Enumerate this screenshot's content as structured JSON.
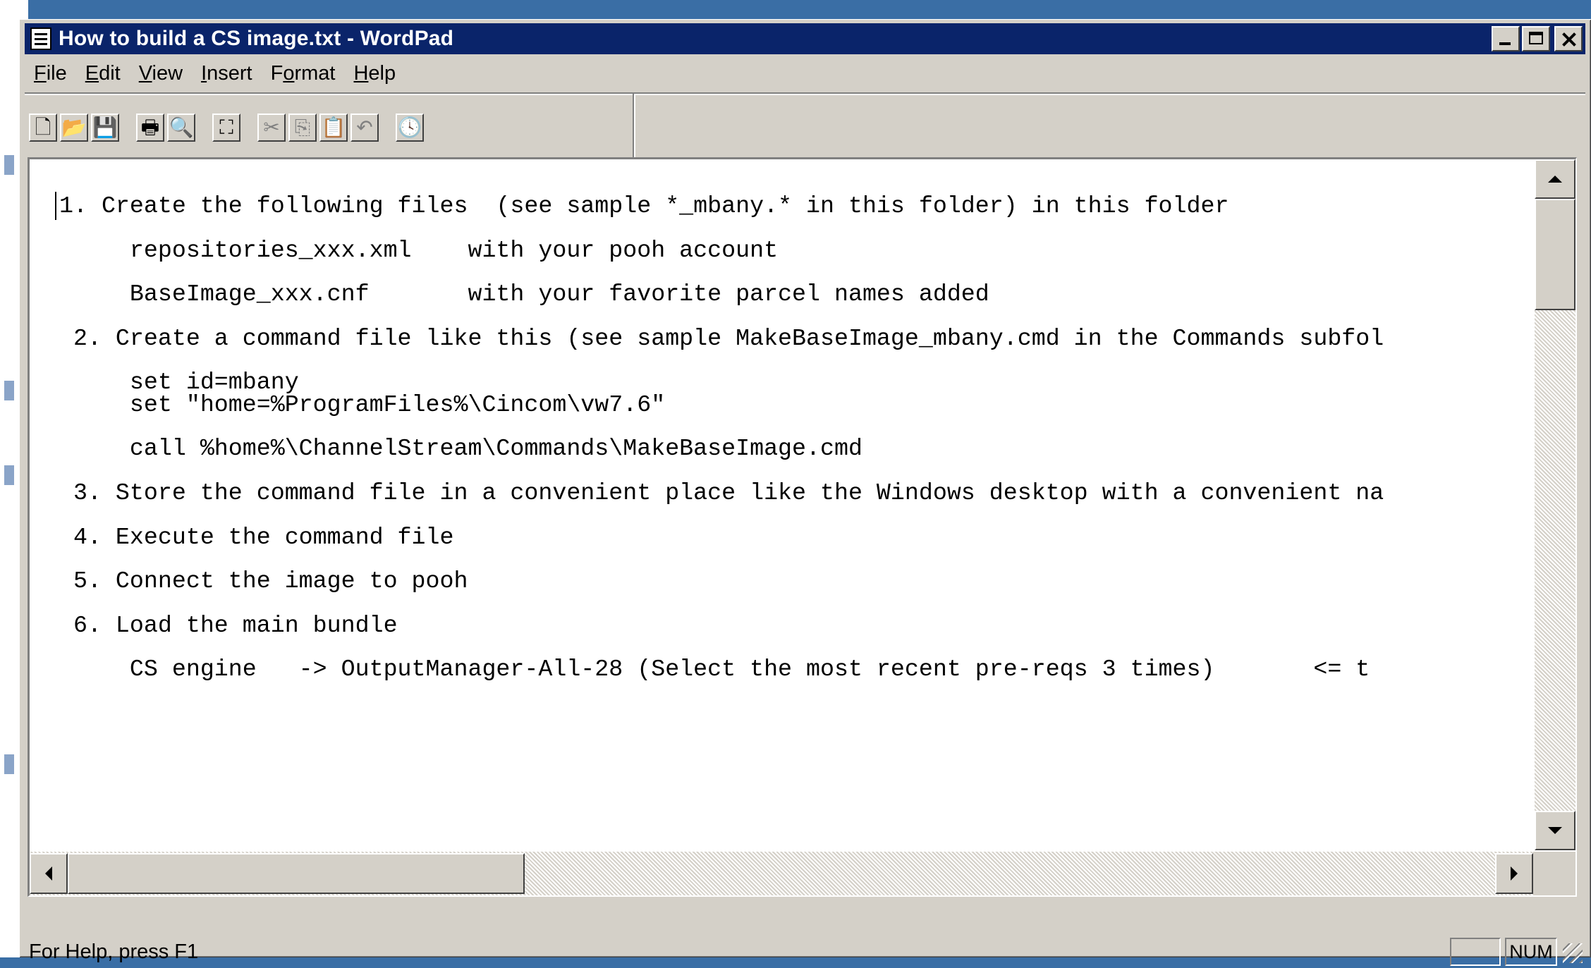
{
  "window": {
    "title": "How to build a CS image.txt - WordPad",
    "controls": {
      "minimize": "minimize",
      "maximize": "maximize",
      "close": "close"
    }
  },
  "menu": [
    {
      "pre": "",
      "key": "F",
      "post": "ile"
    },
    {
      "pre": "",
      "key": "E",
      "post": "dit"
    },
    {
      "pre": "",
      "key": "V",
      "post": "iew"
    },
    {
      "pre": "",
      "key": "I",
      "post": "nsert"
    },
    {
      "pre": "F",
      "key": "o",
      "post": "rmat"
    },
    {
      "pre": "",
      "key": "H",
      "post": "elp"
    }
  ],
  "toolbar": {
    "icons": [
      "new-icon",
      "open-icon",
      "save-icon",
      "print-icon",
      "print-preview-icon",
      "find-icon",
      "cut-icon",
      "copy-icon",
      "paste-icon",
      "undo-icon",
      "insert-datetime-icon"
    ]
  },
  "document": {
    "lines": [
      "1. Create the following files  (see sample *_mbany.* in this folder) in this folder",
      "",
      "     repositories_xxx.xml    with your pooh account",
      "",
      "     BaseImage_xxx.cnf       with your favorite parcel names added",
      "",
      " 2. Create a command file like this (see sample MakeBaseImage_mbany.cmd in the Commands subfol",
      "",
      "     set id=mbany",
      "     set \"home=%ProgramFiles%\\Cincom\\vw7.6\"",
      "",
      "     call %home%\\ChannelStream\\Commands\\MakeBaseImage.cmd",
      "",
      " 3. Store the command file in a convenient place like the Windows desktop with a convenient na",
      "",
      " 4. Execute the command file",
      "",
      " 5. Connect the image to pooh",
      "",
      " 6. Load the main bundle",
      "",
      "     CS engine   -> OutputManager-All-28 (Select the most recent pre-reqs 3 times)       <= t"
    ]
  },
  "status": {
    "help_text": "For Help, press F1",
    "num_indicator": "NUM"
  }
}
